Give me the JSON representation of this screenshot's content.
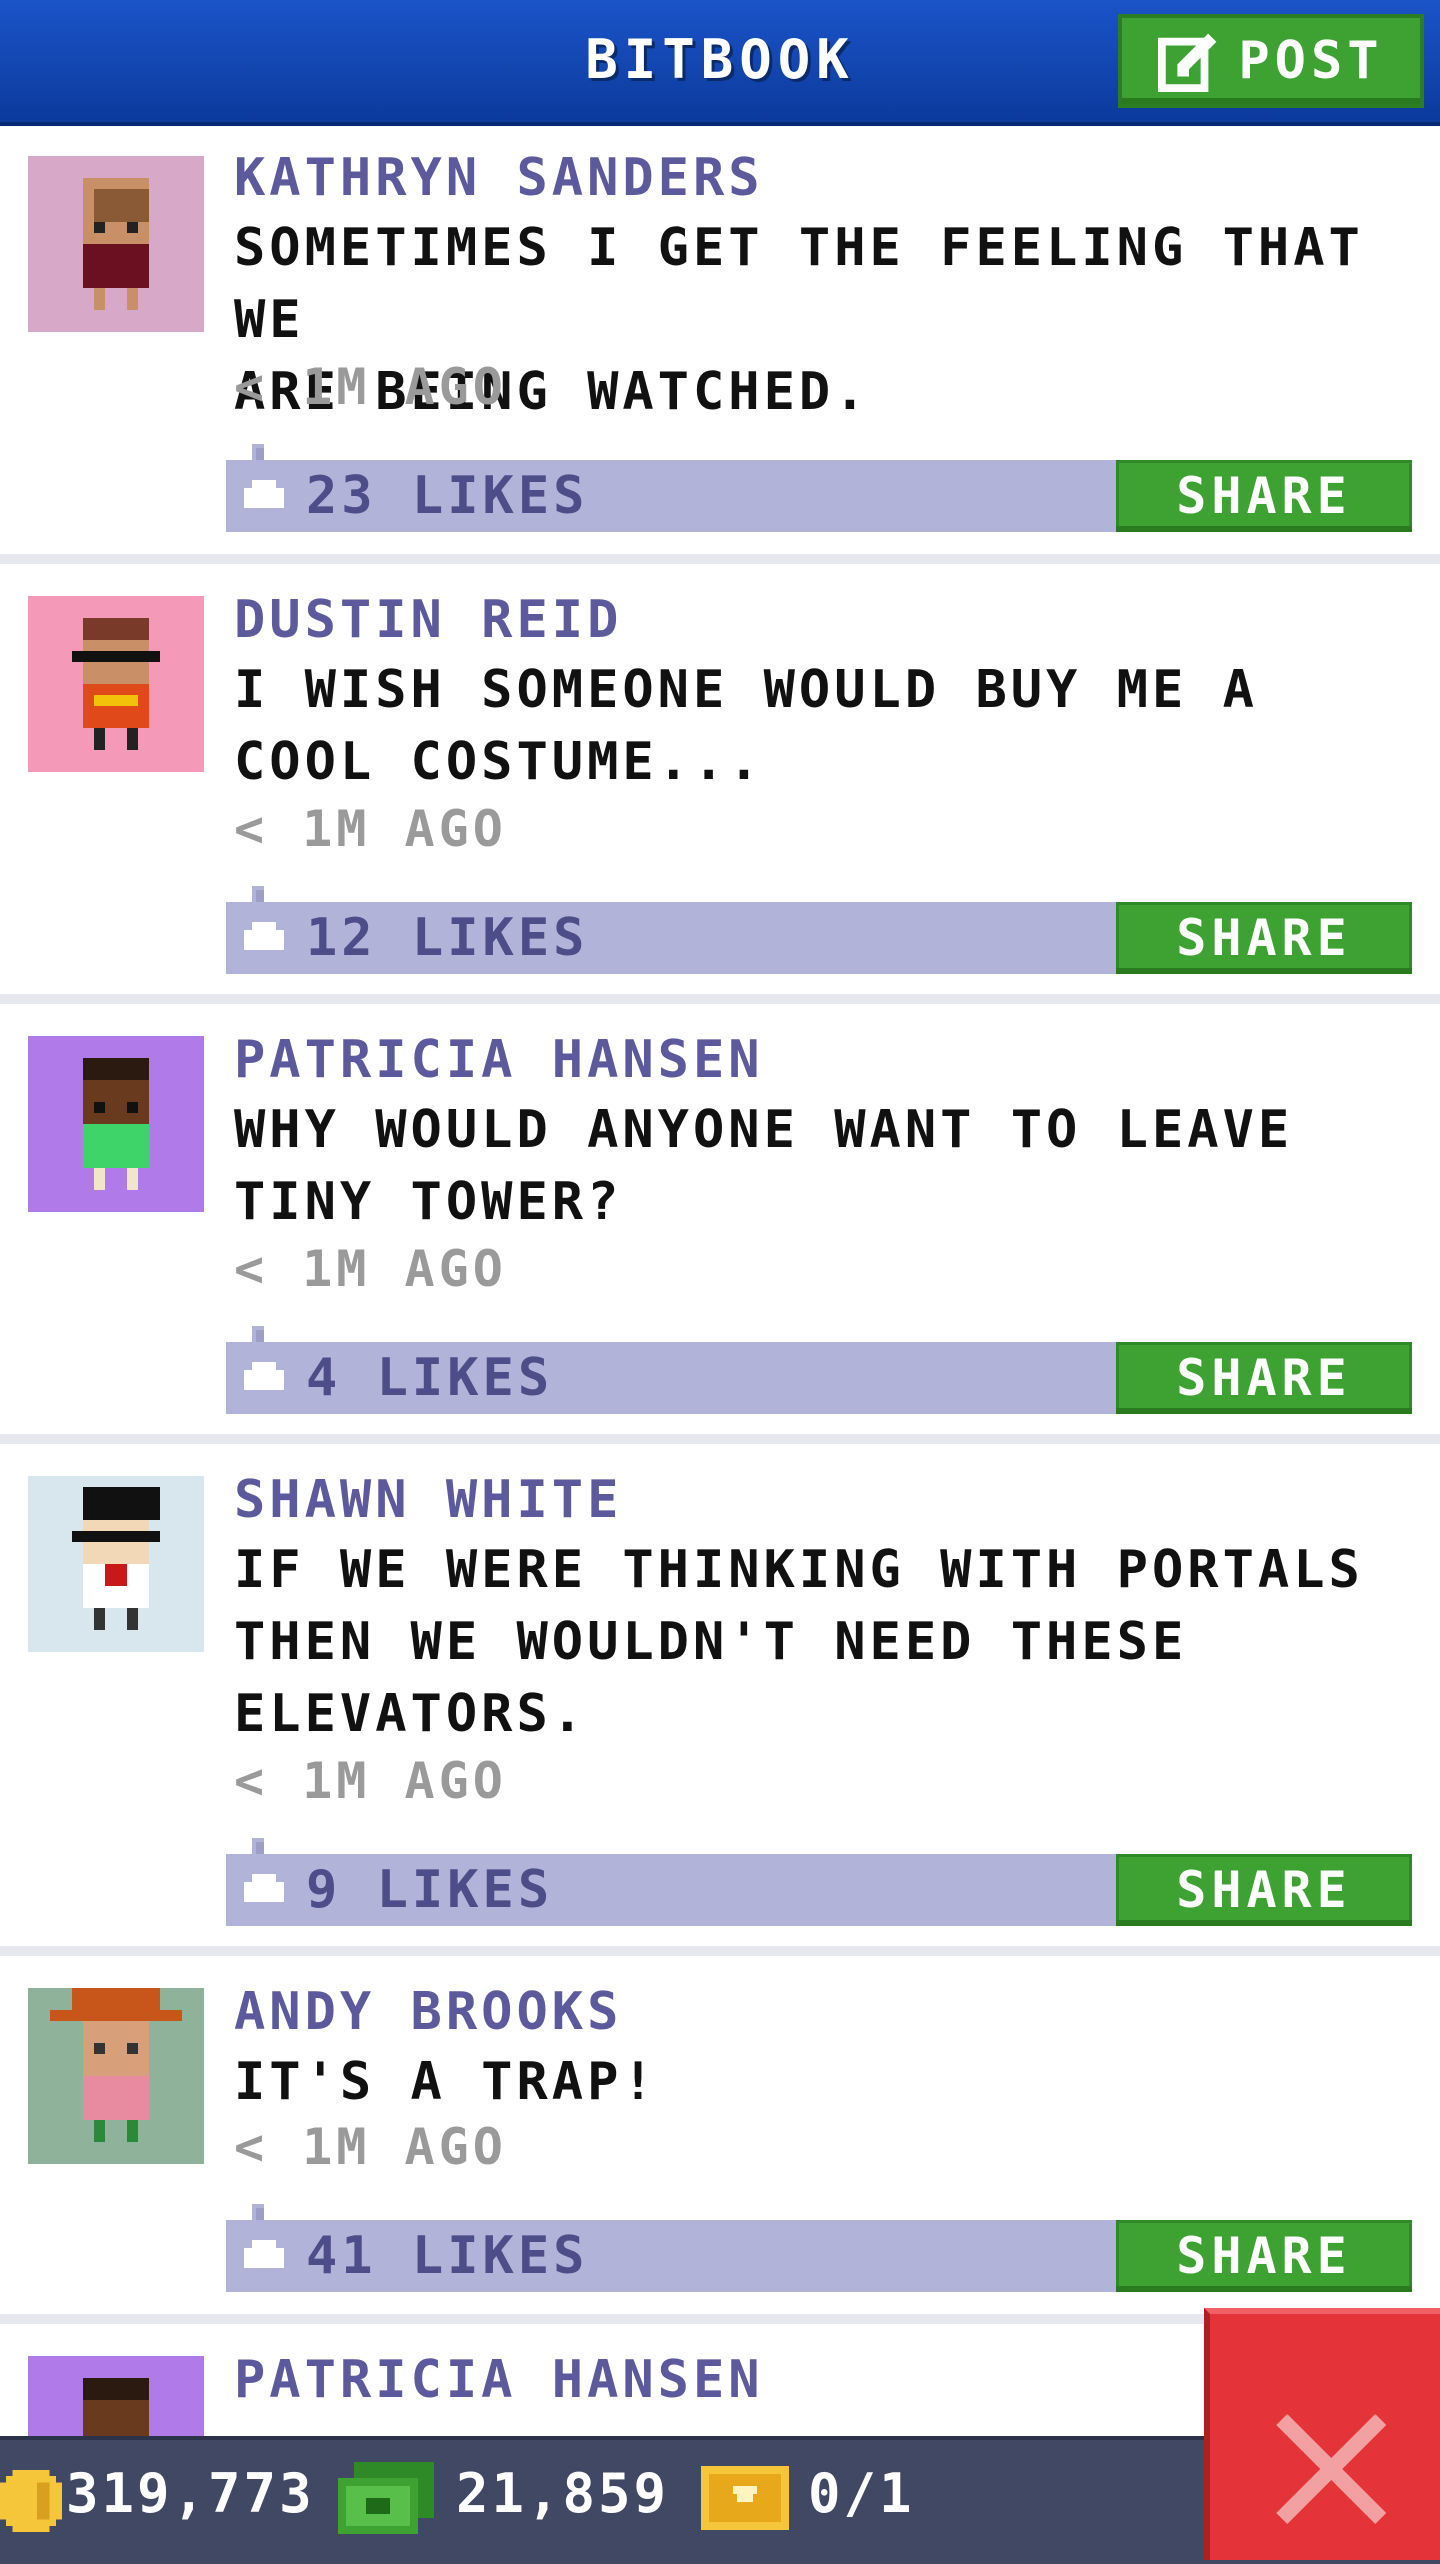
{
  "header": {
    "title": "BITBOOK",
    "post_label": "POST"
  },
  "posts": [
    {
      "name": "KATHRYN SANDERS",
      "lines": [
        "SOMETIMES I GET THE FEELING THAT WE",
        "ARE BEING WATCHED."
      ],
      "time": "< 1M AGO",
      "likes": "23 LIKES",
      "share": "SHARE"
    },
    {
      "name": "DUSTIN REID",
      "lines": [
        "I WISH SOMEONE WOULD BUY ME A",
        "COOL COSTUME..."
      ],
      "time": "< 1M AGO",
      "likes": "12 LIKES",
      "share": "SHARE"
    },
    {
      "name": "PATRICIA HANSEN",
      "lines": [
        "WHY WOULD ANYONE WANT TO LEAVE",
        "TINY TOWER?"
      ],
      "time": "< 1M AGO",
      "likes": "4 LIKES",
      "share": "SHARE"
    },
    {
      "name": "SHAWN WHITE",
      "lines": [
        "IF WE WERE THINKING WITH PORTALS",
        "THEN WE WOULDN'T NEED THESE",
        "ELEVATORS."
      ],
      "time": "< 1M AGO",
      "likes": "9 LIKES",
      "share": "SHARE"
    },
    {
      "name": "ANDY BROOKS",
      "lines": [
        "IT'S A TRAP!"
      ],
      "time": "< 1M AGO",
      "likes": "41 LIKES",
      "share": "SHARE"
    },
    {
      "name": "PATRICIA HANSEN"
    }
  ],
  "status": {
    "coins": "319,773",
    "bux": "21,859",
    "tickets": "0/1"
  },
  "colors": {
    "header_blue": "#1b54c8",
    "accent_green": "#3ea233",
    "name_purple": "#5c5a9c",
    "likes_bar": "#b1b3d8",
    "close_red": "#e4343a",
    "avatar_bg": [
      "#d8a8c8",
      "#f49ab8",
      "#b07ae8",
      "#d8e6ee",
      "#8eb29a",
      "#b07ae8"
    ]
  },
  "icons": [
    "edit-icon",
    "like-icon",
    "coin-icon",
    "bux-icon",
    "ticket-icon",
    "close-icon"
  ]
}
